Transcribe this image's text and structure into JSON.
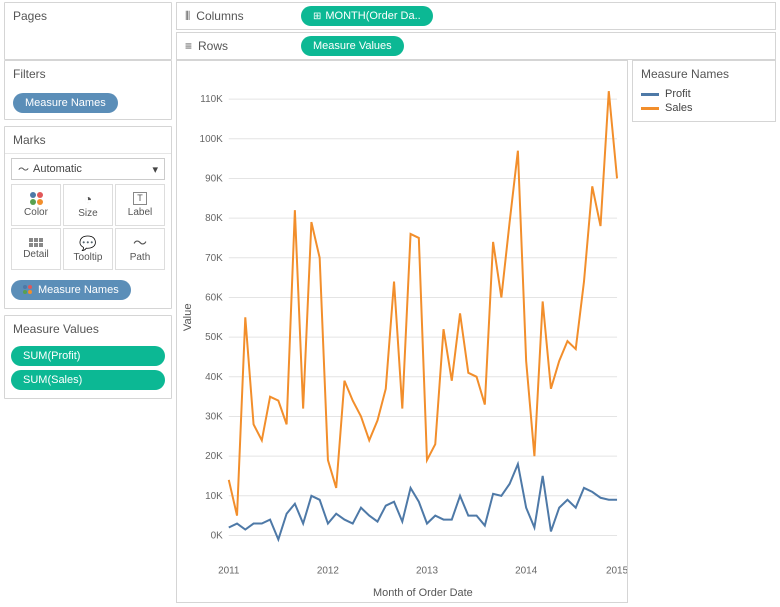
{
  "shelves": {
    "pages_label": "Pages",
    "columns_label": "Columns",
    "rows_label": "Rows",
    "columns_pill": "MONTH(Order Da..",
    "rows_pill": "Measure Values"
  },
  "filters": {
    "title": "Filters",
    "pill": "Measure Names"
  },
  "marks": {
    "title": "Marks",
    "dropdown": "Automatic",
    "cells": {
      "color": "Color",
      "size": "Size",
      "label": "Label",
      "detail": "Detail",
      "tooltip": "Tooltip",
      "path": "Path"
    },
    "pill": "Measure Names"
  },
  "measure_values": {
    "title": "Measure Values",
    "pills": [
      "SUM(Profit)",
      "SUM(Sales)"
    ]
  },
  "legend": {
    "title": "Measure Names",
    "items": [
      {
        "label": "Profit",
        "color": "#4e79a7"
      },
      {
        "label": "Sales",
        "color": "#f28e2b"
      }
    ]
  },
  "chart_data": {
    "type": "line",
    "title": "",
    "xlabel": "Month of Order Date",
    "ylabel": "Value",
    "ylim": [
      -5000,
      115000
    ],
    "xlim": [
      2011,
      2015
    ],
    "x_ticks": [
      2011,
      2012,
      2013,
      2014,
      2015
    ],
    "y_ticks": [
      0,
      10000,
      20000,
      30000,
      40000,
      50000,
      60000,
      70000,
      80000,
      90000,
      100000,
      110000
    ],
    "y_tick_labels": [
      "0K",
      "10K",
      "20K",
      "30K",
      "40K",
      "50K",
      "60K",
      "70K",
      "80K",
      "90K",
      "100K",
      "110K"
    ],
    "x_interval_months": 1,
    "series": [
      {
        "name": "Profit",
        "color": "#4e79a7",
        "values": [
          2000,
          3000,
          1500,
          3000,
          3000,
          4000,
          -1000,
          5500,
          8000,
          3000,
          10000,
          9000,
          3000,
          5500,
          4000,
          3000,
          7000,
          5000,
          3500,
          7500,
          8500,
          3500,
          12000,
          8500,
          3000,
          5000,
          4000,
          4000,
          10000,
          5000,
          5000,
          2500,
          10500,
          10000,
          13000,
          18000,
          7000,
          2000,
          15000,
          1000,
          7000,
          9000,
          7000,
          12000,
          11000,
          9500,
          9000,
          9000
        ]
      },
      {
        "name": "Sales",
        "color": "#f28e2b",
        "values": [
          14000,
          5000,
          55000,
          28000,
          24000,
          35000,
          34000,
          28000,
          82000,
          32000,
          79000,
          70000,
          19000,
          12000,
          39000,
          34000,
          30000,
          24000,
          29000,
          37000,
          64000,
          32000,
          76000,
          75000,
          19000,
          23000,
          52000,
          39000,
          56000,
          41000,
          40000,
          33000,
          74000,
          60000,
          79000,
          97000,
          44000,
          20000,
          59000,
          37000,
          44000,
          49000,
          47000,
          64000,
          88000,
          78000,
          112000,
          90000
        ]
      }
    ]
  }
}
